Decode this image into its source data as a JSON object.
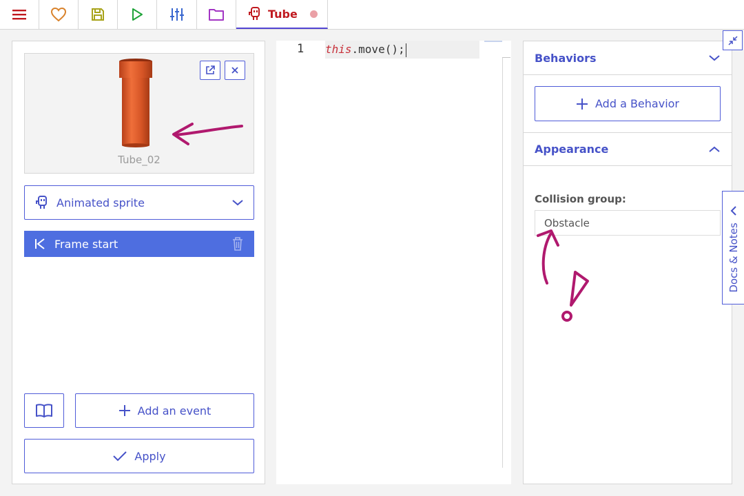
{
  "toolbar": {
    "buttons": [
      {
        "icon": "menu-icon",
        "color": "#c0191f"
      },
      {
        "icon": "heart-icon",
        "color": "#d9822b"
      },
      {
        "icon": "save-icon",
        "color": "#a8a31a"
      },
      {
        "icon": "play-icon",
        "color": "#1fa339"
      },
      {
        "icon": "sliders-icon",
        "color": "#3866cf"
      },
      {
        "icon": "folder-icon",
        "color": "#a335c4"
      }
    ],
    "active_tab": {
      "label": "Tube",
      "icon": "sprite-icon",
      "unsaved": true,
      "color": "#c0191f"
    }
  },
  "left_panel": {
    "preview": {
      "name": "Tube_02"
    },
    "sprite_select": {
      "label": "Animated sprite"
    },
    "events": [
      {
        "label": "Frame start"
      }
    ],
    "add_event_label": "Add an event",
    "apply_label": "Apply"
  },
  "editor": {
    "line_number": "1",
    "code": {
      "keyword": "this",
      "rest": ".move();"
    }
  },
  "right_panel": {
    "behaviors": {
      "title": "Behaviors",
      "add_label": "Add a Behavior"
    },
    "appearance": {
      "title": "Appearance",
      "collision_label": "Collision group:",
      "collision_value": "Obstacle"
    }
  },
  "docs_tab": {
    "label": "Docs & Notes"
  },
  "colors": {
    "accent": "#4652c8",
    "event_row": "#4e6ee0",
    "annotation": "#b0196e"
  }
}
